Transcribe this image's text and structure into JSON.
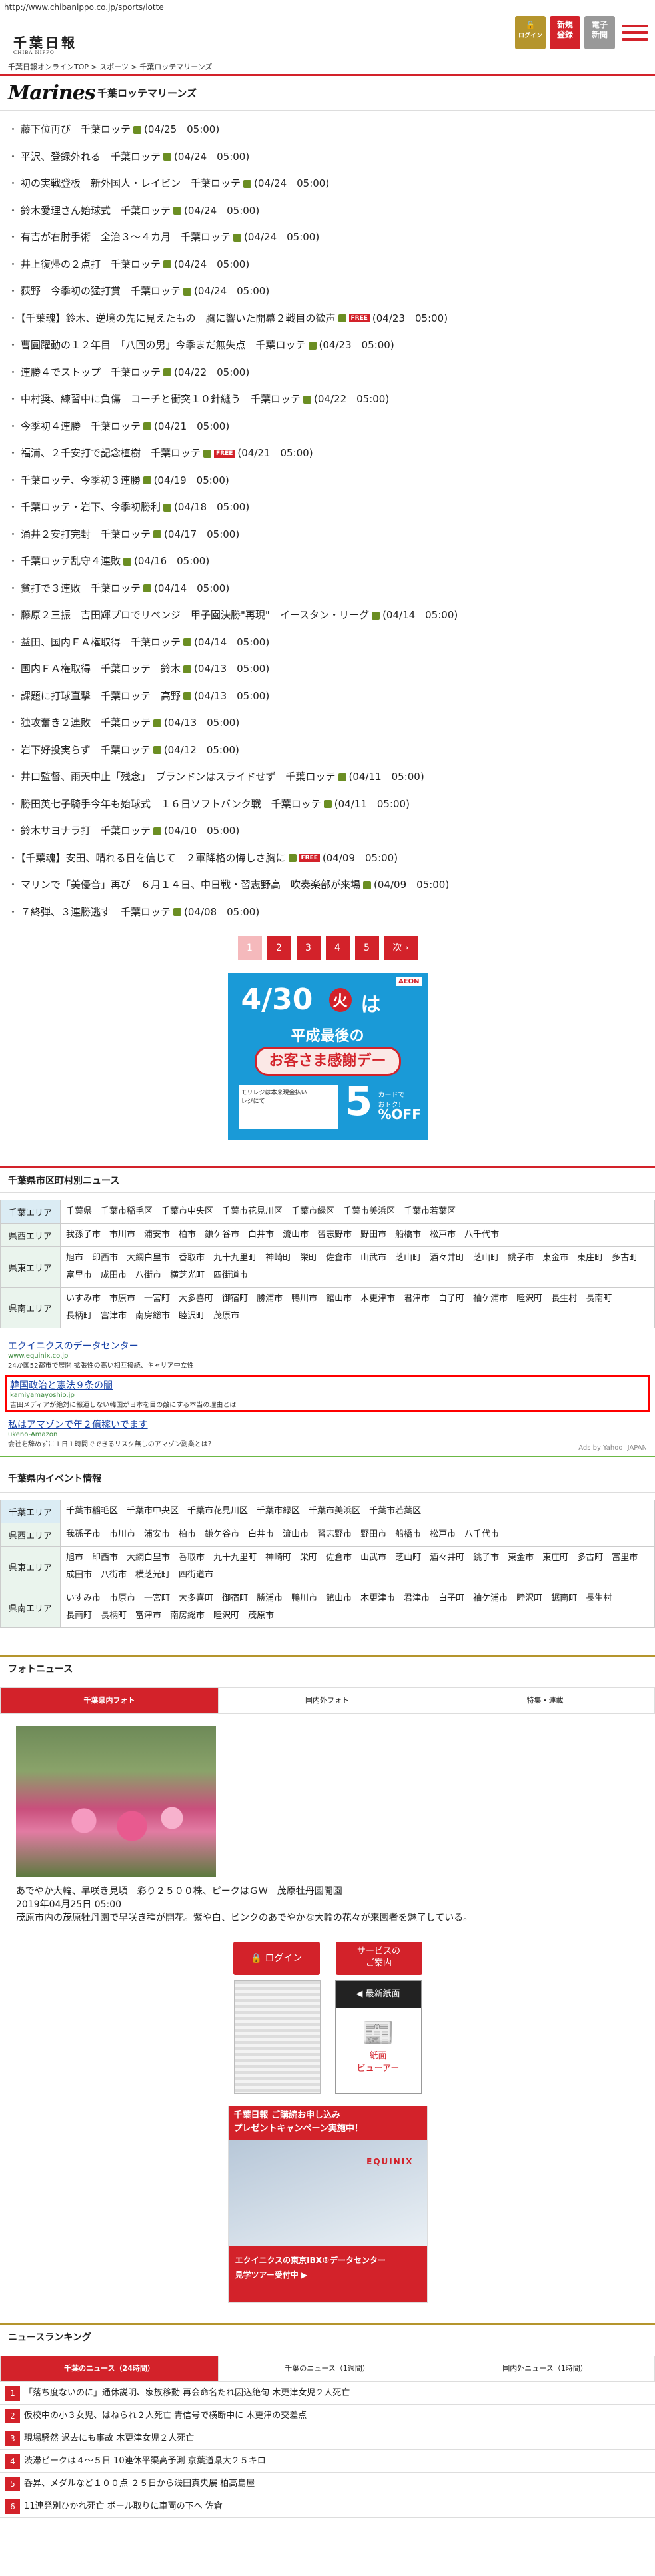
{
  "url": "http://www.chibanippo.co.jp/sports/lotte",
  "site": {
    "logo": "千葉日報",
    "logo_sub": "CHIBA NIPPO"
  },
  "header_buttons": {
    "login": "ログイン",
    "register": "新規\n登録",
    "epaper": "電子\n新聞"
  },
  "breadcrumb": "千葉日報オンラインTOP > スポーツ > 千葉ロッテマリーンズ",
  "team": {
    "logo": "Marines",
    "title": "千葉ロッテマリーンズ"
  },
  "news": [
    {
      "text": "藤下位再び　千葉ロッテ",
      "date": "(04/25　05:00)"
    },
    {
      "text": "平沢、登録外れる　千葉ロッテ",
      "date": "(04/24　05:00)"
    },
    {
      "text": "初の実戦登板　新外国人・レイビン　千葉ロッテ",
      "date": "(04/24　05:00)"
    },
    {
      "text": "鈴木愛理さん始球式　千葉ロッテ",
      "date": "(04/24　05:00)"
    },
    {
      "text": "有吉が右肘手術　全治３～４カ月　千葉ロッテ",
      "date": "(04/24　05:00)"
    },
    {
      "text": "井上復帰の２点打　千葉ロッテ",
      "date": "(04/24　05:00)"
    },
    {
      "text": "荻野　今季初の猛打賞　千葉ロッテ",
      "date": "(04/24　05:00)"
    },
    {
      "text": "【千葉魂】鈴木、逆境の先に見えたもの　胸に響いた開幕２戦目の歓声",
      "date": "(04/23　05:00)",
      "free": true
    },
    {
      "text": "曹圓躍動の１２年目　「八回の男」今季まだ無失点　千葉ロッテ",
      "date": "(04/23　05:00)"
    },
    {
      "text": "連勝４でストップ　千葉ロッテ",
      "date": "(04/22　05:00)"
    },
    {
      "text": "中村奨、練習中に負傷　コーチと衝突１０針縫う　千葉ロッテ",
      "date": "(04/22　05:00)"
    },
    {
      "text": "今季初４連勝　千葉ロッテ",
      "date": "(04/21　05:00)"
    },
    {
      "text": "福浦、２千安打で記念植樹　千葉ロッテ",
      "date": "(04/21　05:00)",
      "free": true
    },
    {
      "text": "千葉ロッテ、今季初３連勝",
      "date": "(04/19　05:00)"
    },
    {
      "text": "千葉ロッテ・岩下、今季初勝利",
      "date": "(04/18　05:00)"
    },
    {
      "text": "涌井２安打完封　千葉ロッテ",
      "date": "(04/17　05:00)"
    },
    {
      "text": "千葉ロッテ乱守４連敗",
      "date": "(04/16　05:00)"
    },
    {
      "text": "貧打で３連敗　千葉ロッテ",
      "date": "(04/14　05:00)"
    },
    {
      "text": "藤原２三振　吉田輝プロでリベンジ　甲子園決勝\"再現\"　イースタン・リーグ",
      "date": "(04/14　05:00)"
    },
    {
      "text": "益田、国内ＦＡ権取得　千葉ロッテ",
      "date": "(04/14　05:00)"
    },
    {
      "text": "国内ＦＡ権取得　千葉ロッテ　鈴木",
      "date": "(04/13　05:00)"
    },
    {
      "text": "課題に打球直撃　千葉ロッテ　高野",
      "date": "(04/13　05:00)"
    },
    {
      "text": "独攻奮き２連敗　千葉ロッテ",
      "date": "(04/13　05:00)"
    },
    {
      "text": "岩下好投実らず　千葉ロッテ",
      "date": "(04/12　05:00)"
    },
    {
      "text": "井口監督、雨天中止「残念」　ブランドンはスライドせず　千葉ロッテ",
      "date": "(04/11　05:00)"
    },
    {
      "text": "勝田英七子騎手今年も始球式　１６日ソフトバンク戦　千葉ロッテ",
      "date": "(04/11　05:00)"
    },
    {
      "text": "鈴木サヨナラ打　千葉ロッテ",
      "date": "(04/10　05:00)"
    },
    {
      "text": "【千葉魂】安田、晴れる日を信じて　２軍降格の悔しさ胸に",
      "date": "(04/09　05:00)",
      "free": true
    },
    {
      "text": "マリンで「美優音」再び　６月１４日、中日戦・習志野高　吹奏楽部が来場",
      "date": "(04/09　05:00)"
    },
    {
      "text": "７終弾、３連勝逃す　千葉ロッテ",
      "date": "(04/08　05:00)"
    }
  ],
  "pager": {
    "pages": [
      "1",
      "2",
      "3",
      "4",
      "5"
    ],
    "next": "次 ›",
    "current": "1"
  },
  "ad1": {
    "date": "4/30",
    "day": "火",
    "ha": "は",
    "aeon": "AEON",
    "heisei": "平成最後の",
    "kansha": "お客さま感謝デー",
    "box": "モリレジは本来現金払い\nレジにて",
    "pct": "5",
    "off": "%OFF",
    "card": "カードで\nおトク！"
  },
  "municipal": {
    "title": "千葉県市区町村別ニュース",
    "rows": [
      {
        "label": "千葉エリア",
        "items": [
          "千葉県",
          "千葉市稲毛区",
          "千葉市中央区",
          "千葉市花見川区",
          "千葉市緑区",
          "千葉市美浜区",
          "千葉市若葉区"
        ]
      },
      {
        "label": "県西エリア",
        "items": [
          "我孫子市",
          "市川市",
          "浦安市",
          "柏市",
          "鎌ケ谷市",
          "白井市",
          "流山市",
          "習志野市",
          "野田市",
          "船橋市",
          "松戸市",
          "八千代市"
        ]
      },
      {
        "label": "県東エリア",
        "items": [
          "旭市",
          "印西市",
          "大網白里市",
          "香取市",
          "九十九里町",
          "神崎町",
          "栄町",
          "佐倉市",
          "山武市",
          "芝山町",
          "酒々井町",
          "芝山町",
          "銚子市",
          "東金市",
          "東庄町",
          "多古町",
          "富里市",
          "成田市",
          "八街市",
          "横芝光町",
          "四街道市"
        ]
      },
      {
        "label": "県南エリア",
        "items": [
          "いすみ市",
          "市原市",
          "一宮町",
          "大多喜町",
          "御宿町",
          "勝浦市",
          "鴨川市",
          "館山市",
          "木更津市",
          "君津市",
          "白子町",
          "袖ケ浦市",
          "睦沢町",
          "長生村",
          "長南町",
          "長柄町",
          "富津市",
          "南房総市",
          "睦沢町",
          "茂原市"
        ]
      }
    ]
  },
  "yads": [
    {
      "title": "エクイニクスのデータセンター",
      "url": "www.equinix.co.jp",
      "desc": "24か国52都市で展開 拡張性の高い相互接続、キャリア中立性"
    },
    {
      "title": "韓国政治と憲法９条の闇",
      "url": "kamiyamayoshio.jp",
      "desc": "吉田メディアが絶対に報道しない韓国が日本を目の敵にする本当の理由とは",
      "highlight": true
    },
    {
      "title": "私はアマゾンで年２億稼いでます",
      "url": "ukeno-Amazon",
      "desc": "会社を辞めずに１日１時間でできるリスク無しのアマゾン副業とは？"
    }
  ],
  "ads_by": "Ads by Yahoo! JAPAN",
  "events": {
    "title": "千葉県内イベント情報",
    "rows": [
      {
        "label": "千葉エリア",
        "items": [
          "千葉市稲毛区",
          "千葉市中央区",
          "千葉市花見川区",
          "千葉市緑区",
          "千葉市美浜区",
          "千葉市若葉区"
        ]
      },
      {
        "label": "県西エリア",
        "items": [
          "我孫子市",
          "市川市",
          "浦安市",
          "柏市",
          "鎌ケ谷市",
          "白井市",
          "流山市",
          "習志野市",
          "野田市",
          "船橋市",
          "松戸市",
          "八千代市"
        ]
      },
      {
        "label": "県東エリア",
        "items": [
          "旭市",
          "印西市",
          "大網白里市",
          "香取市",
          "九十九里町",
          "神崎町",
          "栄町",
          "佐倉市",
          "山武市",
          "芝山町",
          "酒々井町",
          "銚子市",
          "東金市",
          "東庄町",
          "多古町",
          "富里市",
          "成田市",
          "八街市",
          "横芝光町",
          "四街道市"
        ]
      },
      {
        "label": "県南エリア",
        "items": [
          "いすみ市",
          "市原市",
          "一宮町",
          "大多喜町",
          "御宿町",
          "勝浦市",
          "鴨川市",
          "館山市",
          "木更津市",
          "君津市",
          "白子町",
          "袖ケ浦市",
          "睦沢町",
          "鋸南町",
          "長生村",
          "長南町",
          "長柄町",
          "富津市",
          "南房総市",
          "睦沢町",
          "茂原市"
        ]
      }
    ]
  },
  "photo": {
    "title": "フォトニュース",
    "tabs": [
      "千葉県内フォト",
      "国内外フォト",
      "特集・連載"
    ],
    "caption1": "あでやか大輪、早咲き見頃　彩り２５００株、ピークはＧＷ　茂原牡丹園開園",
    "caption2": "2019年04月25日 05:00",
    "caption3": "茂原市内の茂原牡丹園で早咲き種が開花。紫や白、ピンクのあでやかな大輪の花々が来園者を魅了している。"
  },
  "login": {
    "login": "ログイン",
    "service": "サービスの\nご案内",
    "latest": "◀ 最新紙面",
    "viewer": "紙面\nビューアー"
  },
  "ad2": {
    "top": "千葉日報 ご購読お申し込み\nプレゼントキャンペーン実施中！",
    "name": "EQUINIX",
    "bot": "エクイニクスの東京IBX®データセンター\n見学ツアー受付中 ▶"
  },
  "ranking": {
    "title": "ニュースランキング",
    "tabs": [
      "千葉のニュース（24時間）",
      "千葉のニュース（1週間）",
      "国内外ニュース（1時間）"
    ],
    "items": [
      {
        "num": "1",
        "text": "「落ち度ないのに」通休説明、家族移動 再会命名たれ因込絶句 木更津女児２人死亡"
      },
      {
        "num": "2",
        "text": "仮校中の小３女児、はねられ２人死亡 青信号で横断中に 木更津の交差点"
      },
      {
        "num": "3",
        "text": "現場騒然 過去にも事故 木更津女児２人死亡"
      },
      {
        "num": "4",
        "text": "渋滞ピークは４～５日 10連休平渠高予測 京葉道県大２５キロ"
      },
      {
        "num": "5",
        "text": "呑昇、メダルなど１００点 ２５日から浅田真央展 柏高島屋"
      },
      {
        "num": "6",
        "text": "11連発別ひかれ死亡 ボール取りに車両の下へ 佐倉"
      }
    ]
  }
}
